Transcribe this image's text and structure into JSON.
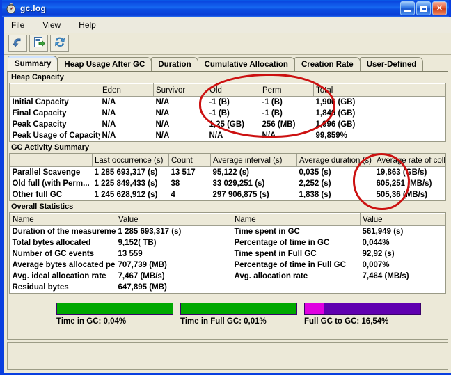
{
  "window": {
    "title": "gc.log",
    "icon": "stopwatch-icon",
    "minimize": "_",
    "maximize": "□",
    "close": "✕"
  },
  "menu": {
    "items": [
      {
        "label": "File",
        "mnemonic": "F"
      },
      {
        "label": "View",
        "mnemonic": "V"
      },
      {
        "label": "Help",
        "mnemonic": "H"
      }
    ]
  },
  "toolbar": {
    "buttons": [
      {
        "icon": "undo-arrow-icon"
      },
      {
        "icon": "document-export-icon"
      },
      {
        "icon": "refresh-icon"
      }
    ]
  },
  "tabs": [
    {
      "label": "Summary",
      "active": true
    },
    {
      "label": "Heap Usage After GC",
      "active": false
    },
    {
      "label": "Duration",
      "active": false
    },
    {
      "label": "Cumulative Allocation",
      "active": false
    },
    {
      "label": "Creation Rate",
      "active": false
    },
    {
      "label": "User-Defined",
      "active": false
    }
  ],
  "heap_capacity": {
    "title": "Heap Capacity",
    "columns": [
      "",
      "Eden",
      "Survivor",
      "Old",
      "Perm",
      "Total"
    ],
    "rows": [
      [
        "Initial Capacity",
        "N/A",
        "N/A",
        "-1 (B)",
        "-1 (B)",
        "1,906 (GB)"
      ],
      [
        "Final Capacity",
        "N/A",
        "N/A",
        "-1 (B)",
        "-1 (B)",
        "1,849 (GB)"
      ],
      [
        "Peak Capacity",
        "N/A",
        "N/A",
        "1,25 (GB)",
        "256 (MB)",
        "1,996 (GB)"
      ],
      [
        "Peak Usage of Capacity",
        "N/A",
        "N/A",
        "N/A",
        "N/A",
        "99,859%"
      ]
    ]
  },
  "gc_activity": {
    "title": "GC Activity Summary",
    "columns": [
      "",
      "Last occurrence (s)",
      "Count",
      "Average interval (s)",
      "Average duration (s)",
      "Average rate of coll..."
    ],
    "rows": [
      [
        "Parallel Scavenge",
        "1 285 693,317 (s)",
        "13 517",
        "95,122 (s)",
        "0,035 (s)",
        "19,863 (GB/s)"
      ],
      [
        "Old full (with Perm...",
        "1 225 849,433 (s)",
        "38",
        "33 029,251 (s)",
        "2,252 (s)",
        "605,251 (MB/s)"
      ],
      [
        "Other full GC",
        "1 245 628,912 (s)",
        "4",
        "297 906,875 (s)",
        "1,838 (s)",
        "505,36 (MB/s)"
      ]
    ]
  },
  "overall_statistics": {
    "title": "Overall Statistics",
    "columns": [
      "Name",
      "Value",
      "Name",
      "Value"
    ],
    "rows": [
      [
        "Duration of the measurement",
        "1 285 693,317 (s)",
        "Time spent in GC",
        "561,949 (s)"
      ],
      [
        "Total bytes allocated",
        "9,152( TB)",
        "Percentage of time in GC",
        "0,044%"
      ],
      [
        "Number of GC events",
        "13 559",
        "Time spent in Full GC",
        "92,92 (s)"
      ],
      [
        "Average bytes allocated per GC",
        "707,739 (MB)",
        "Percentage of time in Full GC",
        "0,007%"
      ],
      [
        "Avg. ideal allocation rate",
        "7,467 (MB/s)",
        "Avg. allocation rate",
        "7,464 (MB/s)"
      ],
      [
        "Residual bytes",
        "647,895 (MB)",
        "",
        ""
      ]
    ]
  },
  "gauges": [
    {
      "label": "Time in GC: 0,04%",
      "segments": [
        {
          "color": "#00a800",
          "percent": 100
        }
      ]
    },
    {
      "label": "Time in Full GC: 0,01%",
      "segments": [
        {
          "color": "#00a800",
          "percent": 100
        }
      ]
    },
    {
      "label": "Full GC to GC: 16,54%",
      "segments": [
        {
          "color": "#e000e0",
          "percent": 16.54
        },
        {
          "color": "#6000b0",
          "percent": 83.46
        }
      ]
    }
  ],
  "annotations": [
    {
      "name": "red-circle-gc-interval-duration"
    },
    {
      "name": "red-circle-gc-time-values"
    }
  ],
  "colors": {
    "title_blue": "#0a46df",
    "panel": "#ece9d8",
    "green": "#00a800",
    "magenta": "#e000e0",
    "purple": "#6000b0",
    "annotation_red": "#cc1111"
  }
}
